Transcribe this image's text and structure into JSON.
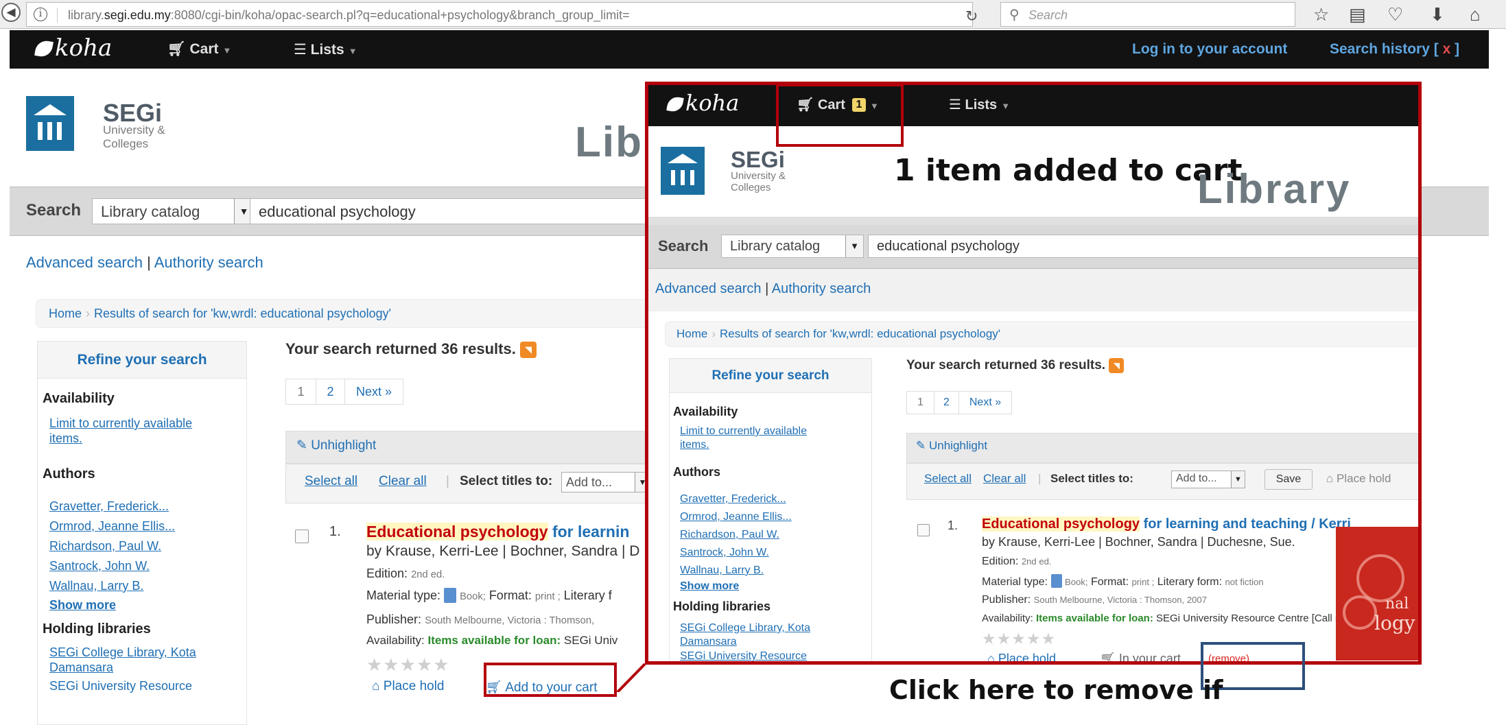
{
  "browser": {
    "url_prefix": "library.",
    "url_domain": "segi.edu.my",
    "url_rest": ":8080/cgi-bin/koha/opac-search.pl?q=educational+psychology&branch_group_limit=",
    "search_placeholder": "Search"
  },
  "nav": {
    "logo_text": "koha",
    "cart_label": "Cart",
    "lists_label": "Lists",
    "login_label": "Log in to your account",
    "history_label": "Search history",
    "history_open": "[",
    "history_x": "x",
    "history_close": "]"
  },
  "brand": {
    "name": "SEGi",
    "sub_line1": "University &",
    "sub_line2": "Colleges",
    "library_title_partial": "Lib",
    "library_title": "Library"
  },
  "search": {
    "label": "Search",
    "catalog_option": "Library catalog",
    "query": "educational psychology"
  },
  "links": {
    "advanced": "Advanced search",
    "pipe": "|",
    "authority": "Authority search"
  },
  "breadcrumb": {
    "home": "Home",
    "sep": "›",
    "current": "Results of search for 'kw,wrdl: educational psychology'"
  },
  "facets": {
    "refine": "Refine your search",
    "availability_heading": "Availability",
    "limit_line1": "Limit to currently available",
    "limit_line2": "items.",
    "authors_heading": "Authors",
    "authors": [
      "Gravetter, Frederick...",
      "Ormrod, Jeanne Ellis...",
      "Richardson, Paul W.",
      "Santrock, John W.",
      "Wallnau, Larry B."
    ],
    "show_more": "Show more",
    "holding_heading": "Holding libraries",
    "lib1_line1": "SEGi College Library, Kota",
    "lib1_line2": "Damansara",
    "lib2_line1": "SEGi University Resource"
  },
  "results": {
    "summary": "Your search returned 36 results.",
    "rss_glyph": "◥",
    "pages": [
      "1",
      "2",
      "Next »"
    ],
    "unhighlight": "Unhighlight",
    "select_all": "Select all",
    "clear_all": "Clear all",
    "bar": "|",
    "select_titles": "Select titles to:",
    "add_to": "Add to...",
    "save": "Save",
    "place_hold_top": "Place hold",
    "item": {
      "number": "1.",
      "title_hl": "Educational psychology",
      "title_rest": "for learning and teaching / Kerri",
      "title_rest_bg": "for learnin",
      "authors": "by Krause, Kerri-Lee | Bochner, Sandra | Duchesne, Sue.",
      "authors_bg": "by Krause, Kerri-Lee | Bochner, Sandra | D",
      "edition_label": "Edition:",
      "edition_value": "2nd ed.",
      "material_label": "Material type:",
      "material_value": "Book;",
      "format_label": "Format:",
      "format_value": "print ;",
      "literary_label": "Literary form:",
      "literary_value": "not fiction",
      "literary_bg": "Literary f",
      "publisher_label": "Publisher:",
      "publisher_value": "South Melbourne, Victoria : Thomson, 2007",
      "publisher_bg": "South Melbourne, Victoria : Thomson,",
      "availability_label": "Availability:",
      "availability_value": "Items available for loan:",
      "availability_place": "SEGi University Resource Centre [Call nu",
      "availability_place_bg": "SEGi Univ",
      "stars": "★★★★★",
      "place_hold": "Place hold",
      "add_to_cart": "Add to your cart",
      "in_your_cart": "In your cart",
      "remove": "(remove)"
    }
  },
  "overlay": {
    "cart_count": "1",
    "added_text": "1 item added to cart",
    "cover_word_1": "nal",
    "cover_word_2": "logy"
  },
  "annotations": {
    "caption_bottom": "Click here to remove if"
  },
  "colors": {
    "annotation_red": "#b3000b",
    "annotation_blue": "#2d4f7c",
    "link_blue": "#1f6fb4",
    "title_highlight_red": "#c2000b",
    "available_green": "#2a8a2a",
    "cart_badge": "#f1d46a"
  }
}
